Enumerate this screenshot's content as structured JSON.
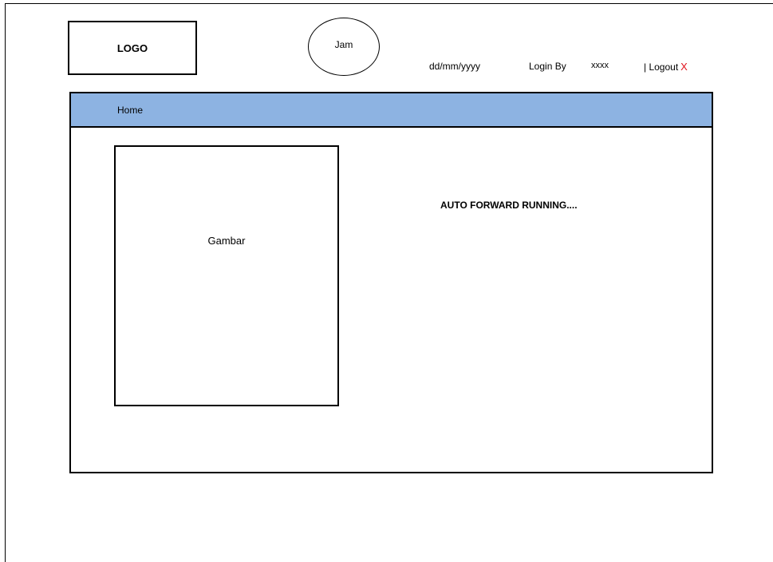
{
  "header": {
    "logo_label": "LOGO",
    "clock_label": "Jam",
    "date_placeholder": "dd/mm/yyyy",
    "login_label": "Login By",
    "login_user": "xxxx",
    "logout_label": "| Logout",
    "logout_icon": "X"
  },
  "nav": {
    "items": [
      {
        "label": "Home"
      }
    ]
  },
  "main": {
    "image_placeholder": "Gambar",
    "status_text": "AUTO FORWARD RUNNING...."
  },
  "colors": {
    "nav_background": "#8db3e2",
    "logout_x": "#e0141e"
  }
}
